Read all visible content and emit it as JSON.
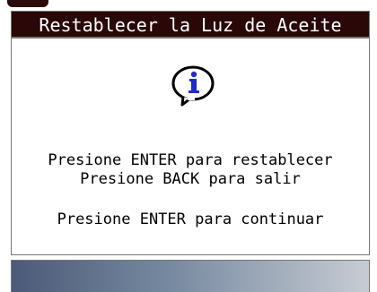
{
  "title": "Restablecer la Luz de Aceite",
  "icon": "info-icon",
  "messages": {
    "line1": "Presione ENTER para restablecer",
    "line2": "Presione BACK para salir",
    "line3": "Presione ENTER para continuar"
  },
  "colors": {
    "title_bg": "#2a0808",
    "icon_blue": "#1f2cc7",
    "footer_gradient_left": "#4b5a78",
    "footer_gradient_right": "#c7ccd3"
  }
}
